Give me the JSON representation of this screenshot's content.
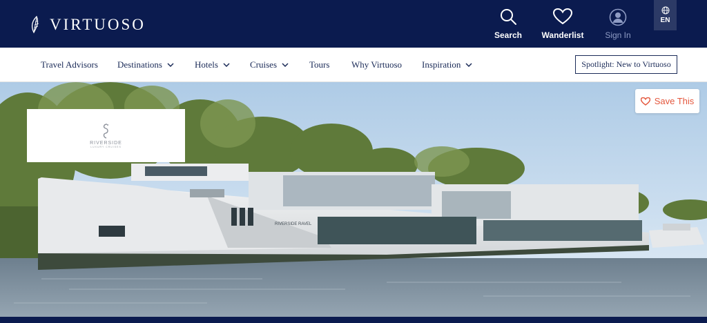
{
  "header": {
    "logo_text": "VIRTUOSO",
    "actions": {
      "search": {
        "label": "Search",
        "icon": "search-icon"
      },
      "wanderlist": {
        "label": "Wanderlist",
        "icon": "heart-icon"
      },
      "signin": {
        "label": "Sign In",
        "icon": "user-icon"
      }
    },
    "language": {
      "label": "EN",
      "icon": "globe-icon"
    },
    "background_color": "#0b1b4f"
  },
  "nav": {
    "items": [
      {
        "label": "Travel Advisors",
        "has_dropdown": false
      },
      {
        "label": "Destinations",
        "has_dropdown": true
      },
      {
        "label": "Hotels",
        "has_dropdown": true
      },
      {
        "label": "Cruises",
        "has_dropdown": true
      },
      {
        "label": "Tours",
        "has_dropdown": false
      },
      {
        "label": "Why Virtuoso",
        "has_dropdown": false
      },
      {
        "label": "Inspiration",
        "has_dropdown": true
      }
    ],
    "spotlight_label": "Spotlight: New to Virtuoso"
  },
  "hero": {
    "brand_logo": {
      "name": "RIVERSIDE",
      "subtitle": "LUXURY CRUISES",
      "icon": "seahorse-icon"
    },
    "ship_name_plate": "RIVERSIDE RAVEL",
    "save_label": "Save This",
    "save_color": "#e4573d"
  }
}
